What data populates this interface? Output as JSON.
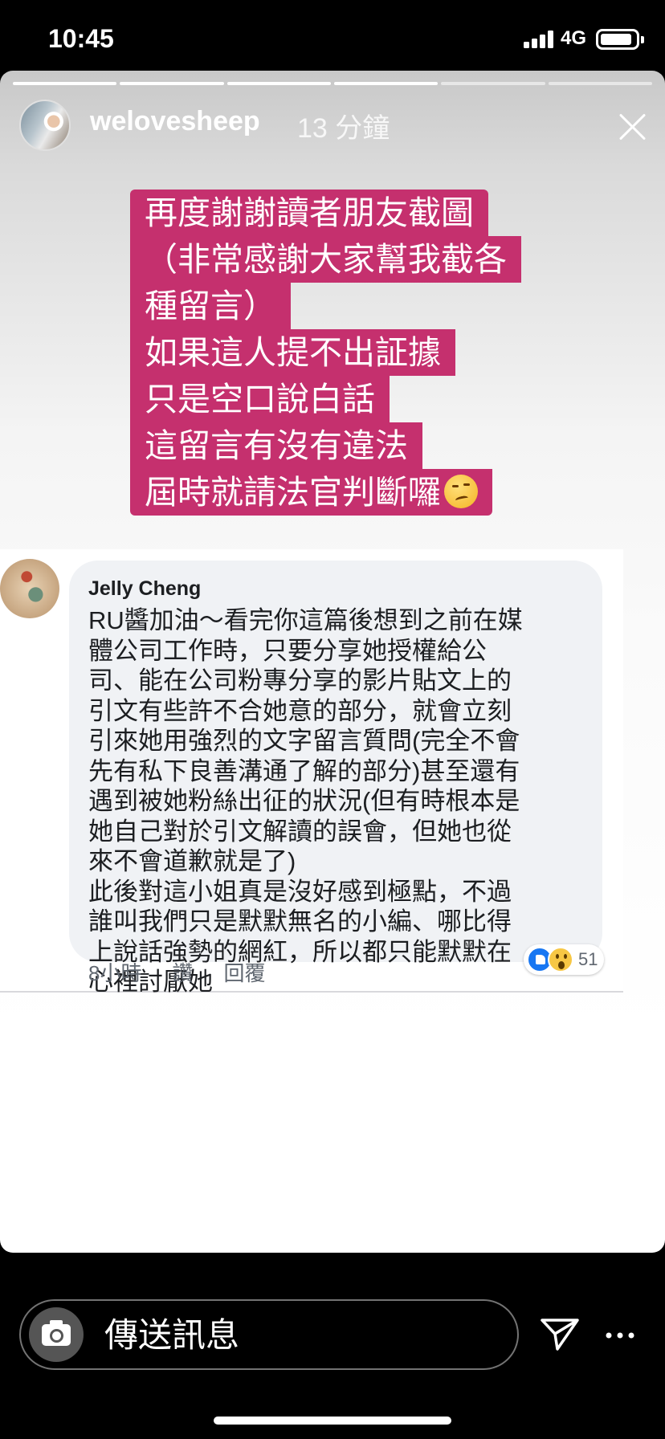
{
  "status_bar": {
    "time": "10:45",
    "network": "4G"
  },
  "story": {
    "progress_segments": 6,
    "progress_active": 5,
    "username": "welovesheep",
    "time_ago": "13 分鐘",
    "caption_lines": [
      "再度謝謝讀者朋友截圖",
      "（非常感謝大家幫我截各",
      "種留言）",
      "如果這人提不出証據",
      "只是空口說白話",
      "這留言有沒有違法",
      "屆時就請法官判斷囉"
    ],
    "caption_emoji": "smirking-face",
    "caption_bg_color": "#c5306e"
  },
  "comment": {
    "author": "Jelly Cheng",
    "lines": [
      "RU醬加油～看完你這篇後想到之前在媒",
      "體公司工作時，只要分享她授權給公",
      "司、能在公司粉專分享的影片貼文上的",
      "引文有些許不合她意的部分，就會立刻",
      "引來她用強烈的文字留言質問(完全不會",
      "先有私下良善溝通了解的部分)甚至還有",
      "遇到被她粉絲出征的狀況(但有時根本是",
      "她自己對於引文解讀的誤會，但她也從",
      "來不會道歉就是了)",
      "此後對這小姐真是沒好感到極點，不過",
      "誰叫我們只是默默無名的小編、哪比得",
      "上說話強勢的網紅，所以都只能默默在",
      "心裡討厭她"
    ],
    "time": "8小時",
    "like_label": "讚",
    "reply_label": "回覆",
    "reaction_count": "51",
    "reaction_icons": [
      "like-icon",
      "wow-icon"
    ]
  },
  "reply_bar": {
    "placeholder": "傳送訊息"
  }
}
